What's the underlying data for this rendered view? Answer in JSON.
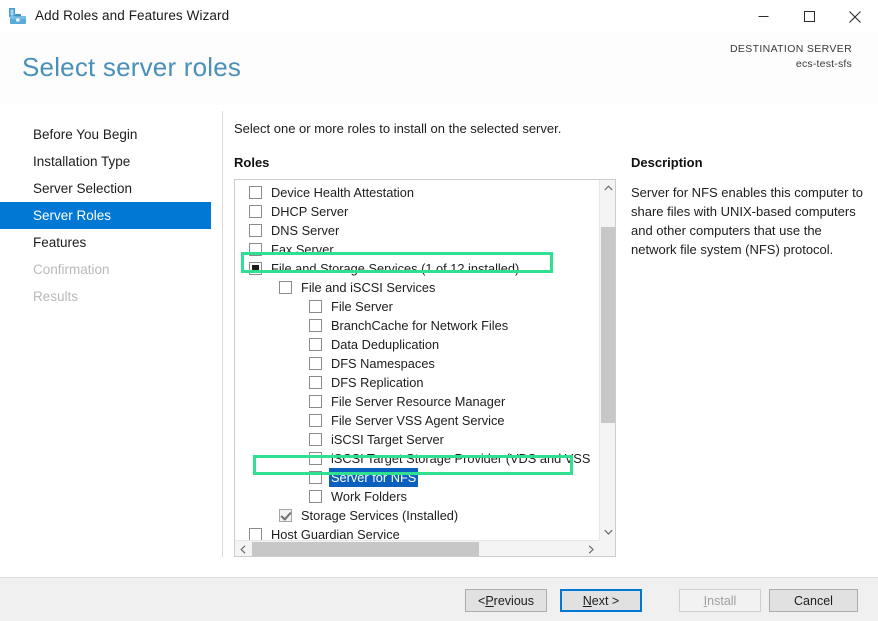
{
  "window": {
    "title": "Add Roles and Features Wizard",
    "icon": "wizard-toolbox-icon",
    "controls": {
      "minimize": "minimize-icon",
      "maximize": "maximize-icon",
      "close": "close-icon"
    }
  },
  "header": {
    "page_title": "Select server roles",
    "destination_label": "DESTINATION SERVER",
    "destination_value": "ecs-test-sfs",
    "title_color": "#4a90b8"
  },
  "sidebar": {
    "selected_index": 3,
    "selection_color": "#0078d4",
    "items": [
      {
        "label": "Before You Begin",
        "state": "normal"
      },
      {
        "label": "Installation Type",
        "state": "normal"
      },
      {
        "label": "Server Selection",
        "state": "normal"
      },
      {
        "label": "Server Roles",
        "state": "selected"
      },
      {
        "label": "Features",
        "state": "normal"
      },
      {
        "label": "Confirmation",
        "state": "disabled"
      },
      {
        "label": "Results",
        "state": "disabled"
      }
    ]
  },
  "main": {
    "instruction": "Select one or more roles to install on the selected server.",
    "roles_label": "Roles",
    "description_label": "Description",
    "description_text": "Server for NFS enables this computer to share files with UNIX-based computers and other computers that use the network file system (NFS) protocol.",
    "roles": [
      {
        "label": "Device Health Attestation",
        "indent": 0,
        "checkbox": "unchecked",
        "expander": "none",
        "selected": false
      },
      {
        "label": "DHCP Server",
        "indent": 0,
        "checkbox": "unchecked",
        "expander": "none",
        "selected": false
      },
      {
        "label": "DNS Server",
        "indent": 0,
        "checkbox": "unchecked",
        "expander": "none",
        "selected": false
      },
      {
        "label": "Fax Server",
        "indent": 0,
        "checkbox": "unchecked",
        "expander": "none",
        "selected": false
      },
      {
        "label": "File and Storage Services (1 of 12 installed)",
        "indent": 0,
        "checkbox": "partial",
        "expander": "expanded",
        "selected": false
      },
      {
        "label": "File and iSCSI Services",
        "indent": 1,
        "checkbox": "unchecked",
        "expander": "expanded",
        "selected": false
      },
      {
        "label": "File Server",
        "indent": 2,
        "checkbox": "unchecked",
        "expander": "none",
        "selected": false
      },
      {
        "label": "BranchCache for Network Files",
        "indent": 2,
        "checkbox": "unchecked",
        "expander": "none",
        "selected": false
      },
      {
        "label": "Data Deduplication",
        "indent": 2,
        "checkbox": "unchecked",
        "expander": "none",
        "selected": false
      },
      {
        "label": "DFS Namespaces",
        "indent": 2,
        "checkbox": "unchecked",
        "expander": "none",
        "selected": false
      },
      {
        "label": "DFS Replication",
        "indent": 2,
        "checkbox": "unchecked",
        "expander": "none",
        "selected": false
      },
      {
        "label": "File Server Resource Manager",
        "indent": 2,
        "checkbox": "unchecked",
        "expander": "none",
        "selected": false
      },
      {
        "label": "File Server VSS Agent Service",
        "indent": 2,
        "checkbox": "unchecked",
        "expander": "none",
        "selected": false
      },
      {
        "label": "iSCSI Target Server",
        "indent": 2,
        "checkbox": "unchecked",
        "expander": "none",
        "selected": false
      },
      {
        "label": "iSCSI Target Storage Provider (VDS and VSS",
        "indent": 2,
        "checkbox": "unchecked",
        "expander": "none",
        "selected": false
      },
      {
        "label": "Server for NFS",
        "indent": 2,
        "checkbox": "unchecked",
        "expander": "none",
        "selected": true
      },
      {
        "label": "Work Folders",
        "indent": 2,
        "checkbox": "unchecked",
        "expander": "none",
        "selected": false
      },
      {
        "label": "Storage Services (Installed)",
        "indent": 1,
        "checkbox": "checked-disabled",
        "expander": "none",
        "selected": false
      },
      {
        "label": "Host Guardian Service",
        "indent": 0,
        "checkbox": "unchecked",
        "expander": "none",
        "selected": false
      }
    ],
    "annotations": [
      {
        "name": "highlight-file-and-storage-services",
        "color": "#2ee08f"
      },
      {
        "name": "highlight-server-for-nfs",
        "color": "#2ee08f"
      }
    ]
  },
  "footer": {
    "buttons": [
      {
        "id": "previous",
        "prefix": "< ",
        "mnemonic": "P",
        "suffix": "revious",
        "state": "normal"
      },
      {
        "id": "next",
        "prefix": "",
        "mnemonic": "N",
        "suffix": "ext >",
        "state": "focused"
      },
      {
        "id": "install",
        "prefix": "",
        "mnemonic": "I",
        "suffix": "nstall",
        "state": "disabled"
      },
      {
        "id": "cancel",
        "prefix": "",
        "mnemonic": "",
        "suffix": "Cancel",
        "state": "normal"
      }
    ]
  }
}
